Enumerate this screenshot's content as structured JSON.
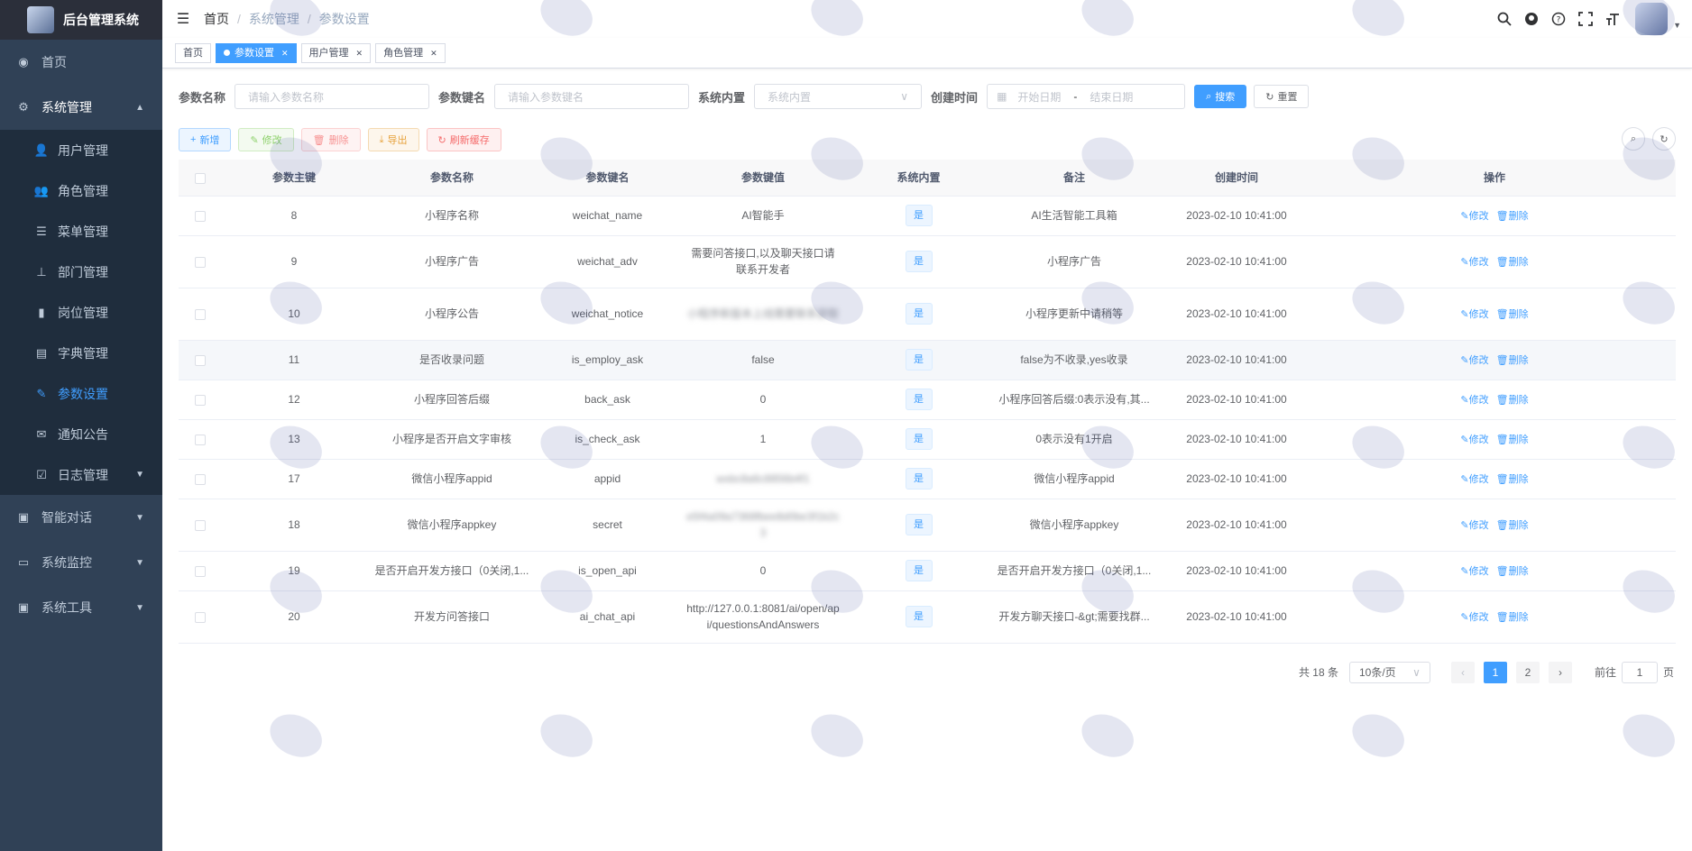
{
  "app": {
    "title": "后台管理系统"
  },
  "sidebar": {
    "home": {
      "label": "首页",
      "icon": "dashboard-icon"
    },
    "system": {
      "label": "系统管理",
      "icon": "gear-icon"
    },
    "sub_items": [
      {
        "label": "用户管理",
        "icon": "user-icon"
      },
      {
        "label": "角色管理",
        "icon": "peoples-icon"
      },
      {
        "label": "菜单管理",
        "icon": "tree-table-icon"
      },
      {
        "label": "部门管理",
        "icon": "tree-icon"
      },
      {
        "label": "岗位管理",
        "icon": "post-icon"
      },
      {
        "label": "字典管理",
        "icon": "dict-icon"
      },
      {
        "label": "参数设置",
        "icon": "edit-icon"
      },
      {
        "label": "通知公告",
        "icon": "message-icon"
      },
      {
        "label": "日志管理",
        "icon": "log-icon"
      }
    ],
    "lower": [
      {
        "label": "智能对话",
        "icon": "chat-icon"
      },
      {
        "label": "系统监控",
        "icon": "monitor-icon"
      },
      {
        "label": "系统工具",
        "icon": "tool-icon"
      }
    ]
  },
  "breadcrumb": [
    "首页",
    "系统管理",
    "参数设置"
  ],
  "tags": [
    {
      "label": "首页"
    },
    {
      "label": "参数设置"
    },
    {
      "label": "用户管理"
    },
    {
      "label": "角色管理"
    }
  ],
  "search": {
    "name_label": "参数名称",
    "name_placeholder": "请输入参数名称",
    "key_label": "参数键名",
    "key_placeholder": "请输入参数键名",
    "type_label": "系统内置",
    "type_placeholder": "系统内置",
    "time_label": "创建时间",
    "start_placeholder": "开始日期",
    "range_sep": "-",
    "end_placeholder": "结束日期",
    "search_btn": "搜索",
    "reset_btn": "重置"
  },
  "toolbar": {
    "add": "新增",
    "edit": "修改",
    "delete": "删除",
    "export": "导出",
    "refresh_cache": "刷新缓存"
  },
  "table": {
    "headers": [
      "参数主键",
      "参数名称",
      "参数键名",
      "参数键值",
      "系统内置",
      "备注",
      "创建时间",
      "操作"
    ],
    "edit_label": "修改",
    "delete_label": "删除",
    "rows": [
      {
        "id": "8",
        "name": "小程序名称",
        "key": "weichat_name",
        "value": "AI智能手",
        "builtin": "是",
        "remark": "AI生活智能工具箱",
        "time": "2023-02-10 10:41:00"
      },
      {
        "id": "9",
        "name": "小程序广告",
        "key": "weichat_adv",
        "value": "需要问答接口,以及聊天接口请联系开发者",
        "builtin": "是",
        "remark": "小程序广告",
        "time": "2023-02-10 10:41:00"
      },
      {
        "id": "10",
        "name": "小程序公告",
        "key": "weichat_notice",
        "value": "小程序新版本上线需要联系获取",
        "builtin": "是",
        "remark": "小程序更新中请稍等",
        "time": "2023-02-10 10:41:00"
      },
      {
        "id": "11",
        "name": "是否收录问题",
        "key": "is_employ_ask",
        "value": "false",
        "builtin": "是",
        "remark": "false为不收录,yes收录",
        "time": "2023-02-10 10:41:00"
      },
      {
        "id": "12",
        "name": "小程序回答后缀",
        "key": "back_ask",
        "value": "0",
        "builtin": "是",
        "remark": "小程序回答后缀:0表示没有,其...",
        "time": "2023-02-10 10:41:00"
      },
      {
        "id": "13",
        "name": "小程序是否开启文字审核",
        "key": "is_check_ask",
        "value": "1",
        "builtin": "是",
        "remark": "0表示没有1开启",
        "time": "2023-02-10 10:41:00"
      },
      {
        "id": "17",
        "name": "微信小程序appid",
        "key": "appid",
        "value": "wxbc8a6c8856b4f1",
        "builtin": "是",
        "remark": "微信小程序appid",
        "time": "2023-02-10 10:41:00"
      },
      {
        "id": "18",
        "name": "微信小程序appkey",
        "key": "secret",
        "value": "e5f4a09a7368fbee8d0be3f1b2c3",
        "builtin": "是",
        "remark": "微信小程序appkey",
        "time": "2023-02-10 10:41:00"
      },
      {
        "id": "19",
        "name": "是否开启开发方接口（0关闭,1...",
        "key": "is_open_api",
        "value": "0",
        "builtin": "是",
        "remark": "是否开启开发方接口（0关闭,1...",
        "time": "2023-02-10 10:41:00"
      },
      {
        "id": "20",
        "name": "开发方问答接口",
        "key": "ai_chat_api",
        "value": "http://127.0.0.1:8081/ai/open/api/questionsAndAnswers",
        "builtin": "是",
        "remark": "开发方聊天接口-&gt;需要找群...",
        "time": "2023-02-10 10:41:00"
      }
    ]
  },
  "pager": {
    "total": "共 18 条",
    "page_size": "10条/页",
    "pages": [
      "1",
      "2"
    ],
    "goto_prefix": "前往",
    "goto_value": "1",
    "goto_suffix": "页"
  },
  "colors": {
    "sidebar_bg": "#304156",
    "primary": "#409eff",
    "submenu_bg": "#1f2d3d"
  }
}
